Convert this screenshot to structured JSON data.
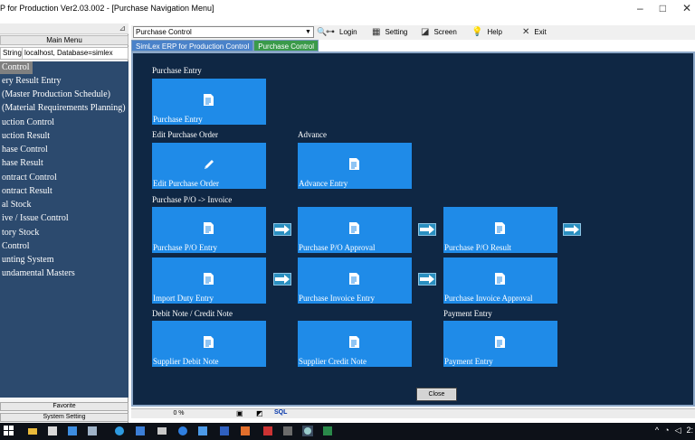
{
  "window": {
    "title": "P for Production Ver2.03.002 - [Purchase Navigation Menu]",
    "minimize": "–",
    "maximize": "□",
    "close": "✕"
  },
  "left_panel": {
    "pin": "⊿",
    "main_menu_label": "Main Menu",
    "conn_label": "String",
    "conn_value": "localhost,  Database=simlex",
    "items": [
      "Control",
      "ery Result Entry",
      "(Master Production Schedule)",
      "(Material Requirements Planning)",
      "uction Control",
      "uction Result",
      "hase Control",
      "hase Result",
      "ontract Control",
      "ontract Result",
      "al Stock",
      "ive / Issue Control",
      "tory Stock",
      "Control",
      "unting System",
      "undamental Masters"
    ],
    "favorite_label": "Favorite",
    "system_setting_label": "System Setting"
  },
  "toolbar": {
    "menu_select_value": "Purchase Control",
    "login": "Login",
    "setting": "Setting",
    "screen": "Screen",
    "help": "Help",
    "exit": "Exit"
  },
  "tabs": [
    "SimLex ERP for Production Control",
    "Purchase Control"
  ],
  "sections": {
    "purchase_entry": "Purchase Entry",
    "edit_purchase_order": "Edit Purchase Order",
    "advance": "Advance",
    "po_invoice": "Purchase P/O -> Invoice",
    "debit_credit": "Debit Note / Credit Note",
    "payment_entry": "Payment Entry"
  },
  "tiles": {
    "purchase_entry": "Purchase Entry",
    "edit_purchase_order": "Edit Purchase Order",
    "advance_entry": "Advance Entry",
    "po_entry": "Purchase P/O Entry",
    "po_approval": "Purchase P/O Approval",
    "po_result": "Purchase P/O Result",
    "import_duty": "Import Duty Entry",
    "invoice_entry": "Purchase Invoice Entry",
    "invoice_approval": "Purchase Invoice Approval",
    "supplier_debit": "Supplier Debit Note",
    "supplier_credit": "Supplier Credit Note",
    "payment_entry": "Payment Entry"
  },
  "close_label": "Close",
  "status": {
    "progress": "0 %",
    "progress_value": 0,
    "sql": "SQL"
  },
  "colors": {
    "background": "#0f2744",
    "tile": "#1f8be8",
    "menu_bg": "#2c4a6e",
    "tab_active": "#3a9a4a"
  },
  "taskbar_tray": {
    "chevron": "^",
    "time_fragment": "2:"
  }
}
